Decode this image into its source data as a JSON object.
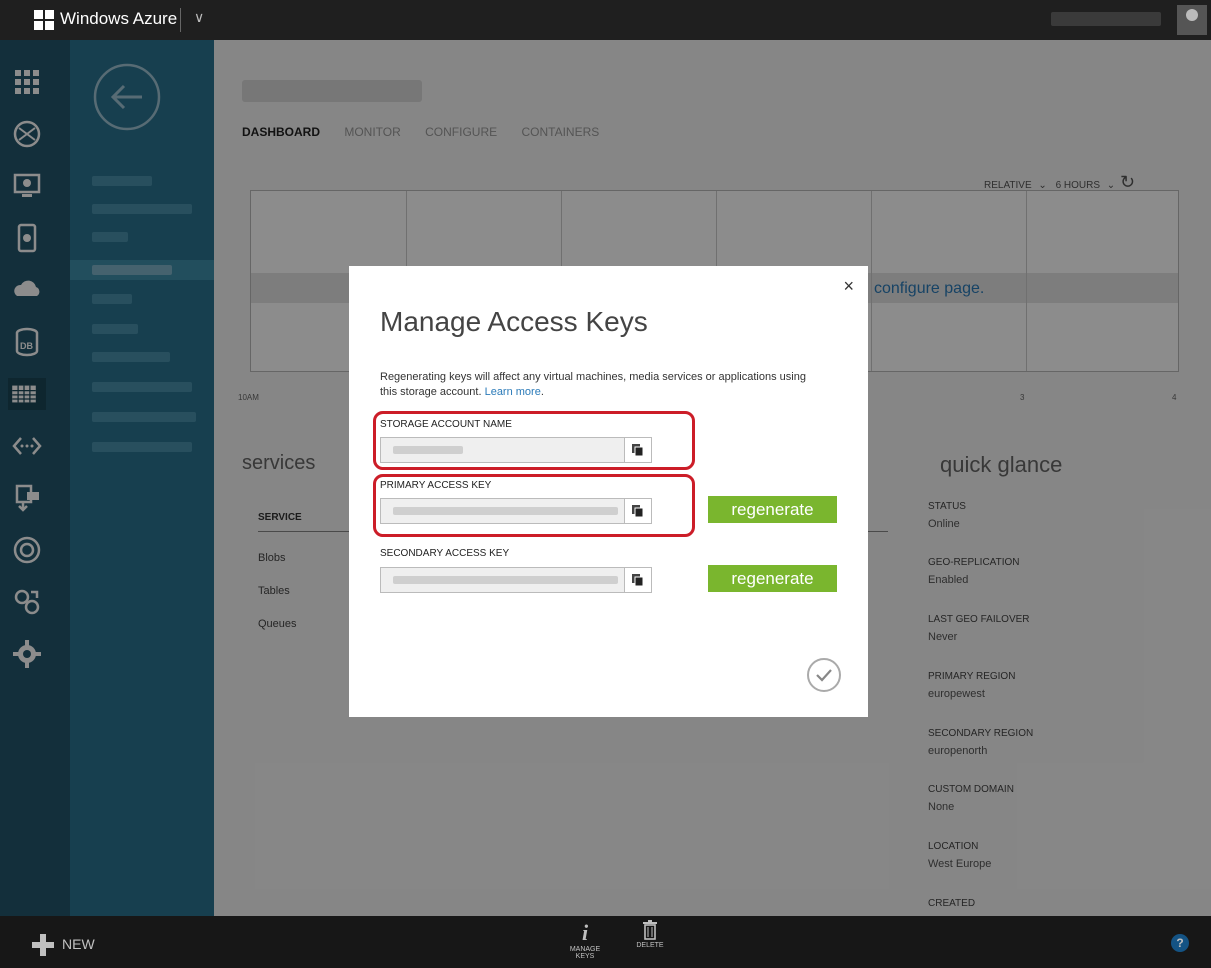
{
  "app": {
    "brand": "Windows Azure"
  },
  "tabs": [
    "DASHBOARD",
    "MONITOR",
    "CONFIGURE",
    "CONTAINERS"
  ],
  "range": {
    "relative": "RELATIVE",
    "hours": "6 HOURS"
  },
  "chart": {
    "axis": [
      "10AM",
      "3",
      "4"
    ],
    "note": "configure page."
  },
  "services": {
    "title": "services",
    "header": "SERVICE",
    "items": [
      "Blobs",
      "Tables",
      "Queues"
    ]
  },
  "quick_glance": {
    "title": "quick glance",
    "items": [
      {
        "label": "STATUS",
        "value": "Online"
      },
      {
        "label": "GEO-REPLICATION",
        "value": "Enabled"
      },
      {
        "label": "LAST GEO FAILOVER",
        "value": "Never"
      },
      {
        "label": "PRIMARY REGION",
        "value": "europewest"
      },
      {
        "label": "SECONDARY REGION",
        "value": "europenorth"
      },
      {
        "label": "CUSTOM DOMAIN",
        "value": "None"
      },
      {
        "label": "LOCATION",
        "value": "West Europe"
      },
      {
        "label": "CREATED",
        "value": ""
      }
    ]
  },
  "modal": {
    "close": "×",
    "title": "Manage Access Keys",
    "desc": "Regenerating keys will affect any virtual machines, media services or applications using this storage account.",
    "learn_more": "Learn more",
    "desc_end": ".",
    "storage_label": "STORAGE ACCOUNT NAME",
    "primary_label": "PRIMARY ACCESS KEY",
    "secondary_label": "SECONDARY ACCESS KEY",
    "regenerate": "regenerate"
  },
  "bottom": {
    "new": "NEW",
    "manage_keys": "MANAGE KEYS",
    "delete": "DELETE",
    "help": "?"
  },
  "colors": {
    "accent_green": "#7ab62e",
    "highlight_red": "#cc1d28",
    "nav_blue": "#2b7491",
    "rail_blue": "#24576c"
  },
  "icons": [
    "windows-logo-icon",
    "chevron-down-icon",
    "user-avatar-icon",
    "all-items-icon",
    "web-sites-icon",
    "virtual-machines-icon",
    "mobile-services-icon",
    "cloud-services-icon",
    "sql-databases-icon",
    "storage-icon",
    "service-bus-icon",
    "media-services-icon",
    "cache-icon",
    "active-directory-icon",
    "settings-icon",
    "back-arrow-icon",
    "refresh-icon",
    "copy-icon",
    "checkmark-icon",
    "plus-icon",
    "info-icon",
    "trash-icon"
  ]
}
